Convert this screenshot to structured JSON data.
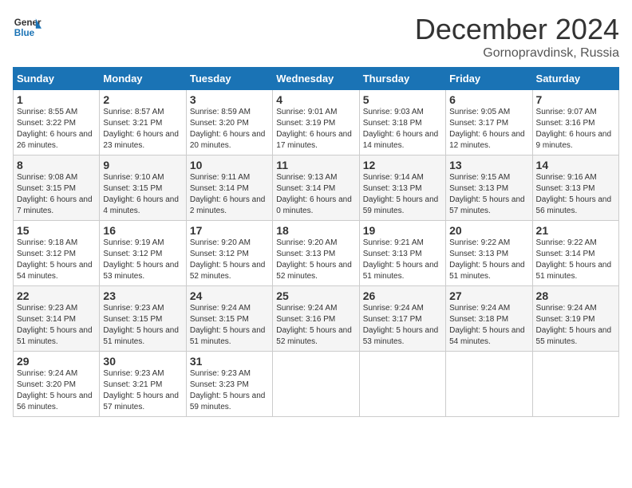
{
  "logo": {
    "line1": "General",
    "line2": "Blue"
  },
  "title": "December 2024",
  "subtitle": "Gornopravdinsk, Russia",
  "days_of_week": [
    "Sunday",
    "Monday",
    "Tuesday",
    "Wednesday",
    "Thursday",
    "Friday",
    "Saturday"
  ],
  "weeks": [
    [
      {
        "day": "1",
        "sunrise": "Sunrise: 8:55 AM",
        "sunset": "Sunset: 3:22 PM",
        "daylight": "Daylight: 6 hours and 26 minutes."
      },
      {
        "day": "2",
        "sunrise": "Sunrise: 8:57 AM",
        "sunset": "Sunset: 3:21 PM",
        "daylight": "Daylight: 6 hours and 23 minutes."
      },
      {
        "day": "3",
        "sunrise": "Sunrise: 8:59 AM",
        "sunset": "Sunset: 3:20 PM",
        "daylight": "Daylight: 6 hours and 20 minutes."
      },
      {
        "day": "4",
        "sunrise": "Sunrise: 9:01 AM",
        "sunset": "Sunset: 3:19 PM",
        "daylight": "Daylight: 6 hours and 17 minutes."
      },
      {
        "day": "5",
        "sunrise": "Sunrise: 9:03 AM",
        "sunset": "Sunset: 3:18 PM",
        "daylight": "Daylight: 6 hours and 14 minutes."
      },
      {
        "day": "6",
        "sunrise": "Sunrise: 9:05 AM",
        "sunset": "Sunset: 3:17 PM",
        "daylight": "Daylight: 6 hours and 12 minutes."
      },
      {
        "day": "7",
        "sunrise": "Sunrise: 9:07 AM",
        "sunset": "Sunset: 3:16 PM",
        "daylight": "Daylight: 6 hours and 9 minutes."
      }
    ],
    [
      {
        "day": "8",
        "sunrise": "Sunrise: 9:08 AM",
        "sunset": "Sunset: 3:15 PM",
        "daylight": "Daylight: 6 hours and 7 minutes."
      },
      {
        "day": "9",
        "sunrise": "Sunrise: 9:10 AM",
        "sunset": "Sunset: 3:15 PM",
        "daylight": "Daylight: 6 hours and 4 minutes."
      },
      {
        "day": "10",
        "sunrise": "Sunrise: 9:11 AM",
        "sunset": "Sunset: 3:14 PM",
        "daylight": "Daylight: 6 hours and 2 minutes."
      },
      {
        "day": "11",
        "sunrise": "Sunrise: 9:13 AM",
        "sunset": "Sunset: 3:14 PM",
        "daylight": "Daylight: 6 hours and 0 minutes."
      },
      {
        "day": "12",
        "sunrise": "Sunrise: 9:14 AM",
        "sunset": "Sunset: 3:13 PM",
        "daylight": "Daylight: 5 hours and 59 minutes."
      },
      {
        "day": "13",
        "sunrise": "Sunrise: 9:15 AM",
        "sunset": "Sunset: 3:13 PM",
        "daylight": "Daylight: 5 hours and 57 minutes."
      },
      {
        "day": "14",
        "sunrise": "Sunrise: 9:16 AM",
        "sunset": "Sunset: 3:13 PM",
        "daylight": "Daylight: 5 hours and 56 minutes."
      }
    ],
    [
      {
        "day": "15",
        "sunrise": "Sunrise: 9:18 AM",
        "sunset": "Sunset: 3:12 PM",
        "daylight": "Daylight: 5 hours and 54 minutes."
      },
      {
        "day": "16",
        "sunrise": "Sunrise: 9:19 AM",
        "sunset": "Sunset: 3:12 PM",
        "daylight": "Daylight: 5 hours and 53 minutes."
      },
      {
        "day": "17",
        "sunrise": "Sunrise: 9:20 AM",
        "sunset": "Sunset: 3:12 PM",
        "daylight": "Daylight: 5 hours and 52 minutes."
      },
      {
        "day": "18",
        "sunrise": "Sunrise: 9:20 AM",
        "sunset": "Sunset: 3:13 PM",
        "daylight": "Daylight: 5 hours and 52 minutes."
      },
      {
        "day": "19",
        "sunrise": "Sunrise: 9:21 AM",
        "sunset": "Sunset: 3:13 PM",
        "daylight": "Daylight: 5 hours and 51 minutes."
      },
      {
        "day": "20",
        "sunrise": "Sunrise: 9:22 AM",
        "sunset": "Sunset: 3:13 PM",
        "daylight": "Daylight: 5 hours and 51 minutes."
      },
      {
        "day": "21",
        "sunrise": "Sunrise: 9:22 AM",
        "sunset": "Sunset: 3:14 PM",
        "daylight": "Daylight: 5 hours and 51 minutes."
      }
    ],
    [
      {
        "day": "22",
        "sunrise": "Sunrise: 9:23 AM",
        "sunset": "Sunset: 3:14 PM",
        "daylight": "Daylight: 5 hours and 51 minutes."
      },
      {
        "day": "23",
        "sunrise": "Sunrise: 9:23 AM",
        "sunset": "Sunset: 3:15 PM",
        "daylight": "Daylight: 5 hours and 51 minutes."
      },
      {
        "day": "24",
        "sunrise": "Sunrise: 9:24 AM",
        "sunset": "Sunset: 3:15 PM",
        "daylight": "Daylight: 5 hours and 51 minutes."
      },
      {
        "day": "25",
        "sunrise": "Sunrise: 9:24 AM",
        "sunset": "Sunset: 3:16 PM",
        "daylight": "Daylight: 5 hours and 52 minutes."
      },
      {
        "day": "26",
        "sunrise": "Sunrise: 9:24 AM",
        "sunset": "Sunset: 3:17 PM",
        "daylight": "Daylight: 5 hours and 53 minutes."
      },
      {
        "day": "27",
        "sunrise": "Sunrise: 9:24 AM",
        "sunset": "Sunset: 3:18 PM",
        "daylight": "Daylight: 5 hours and 54 minutes."
      },
      {
        "day": "28",
        "sunrise": "Sunrise: 9:24 AM",
        "sunset": "Sunset: 3:19 PM",
        "daylight": "Daylight: 5 hours and 55 minutes."
      }
    ],
    [
      {
        "day": "29",
        "sunrise": "Sunrise: 9:24 AM",
        "sunset": "Sunset: 3:20 PM",
        "daylight": "Daylight: 5 hours and 56 minutes."
      },
      {
        "day": "30",
        "sunrise": "Sunrise: 9:23 AM",
        "sunset": "Sunset: 3:21 PM",
        "daylight": "Daylight: 5 hours and 57 minutes."
      },
      {
        "day": "31",
        "sunrise": "Sunrise: 9:23 AM",
        "sunset": "Sunset: 3:23 PM",
        "daylight": "Daylight: 5 hours and 59 minutes."
      },
      null,
      null,
      null,
      null
    ]
  ]
}
